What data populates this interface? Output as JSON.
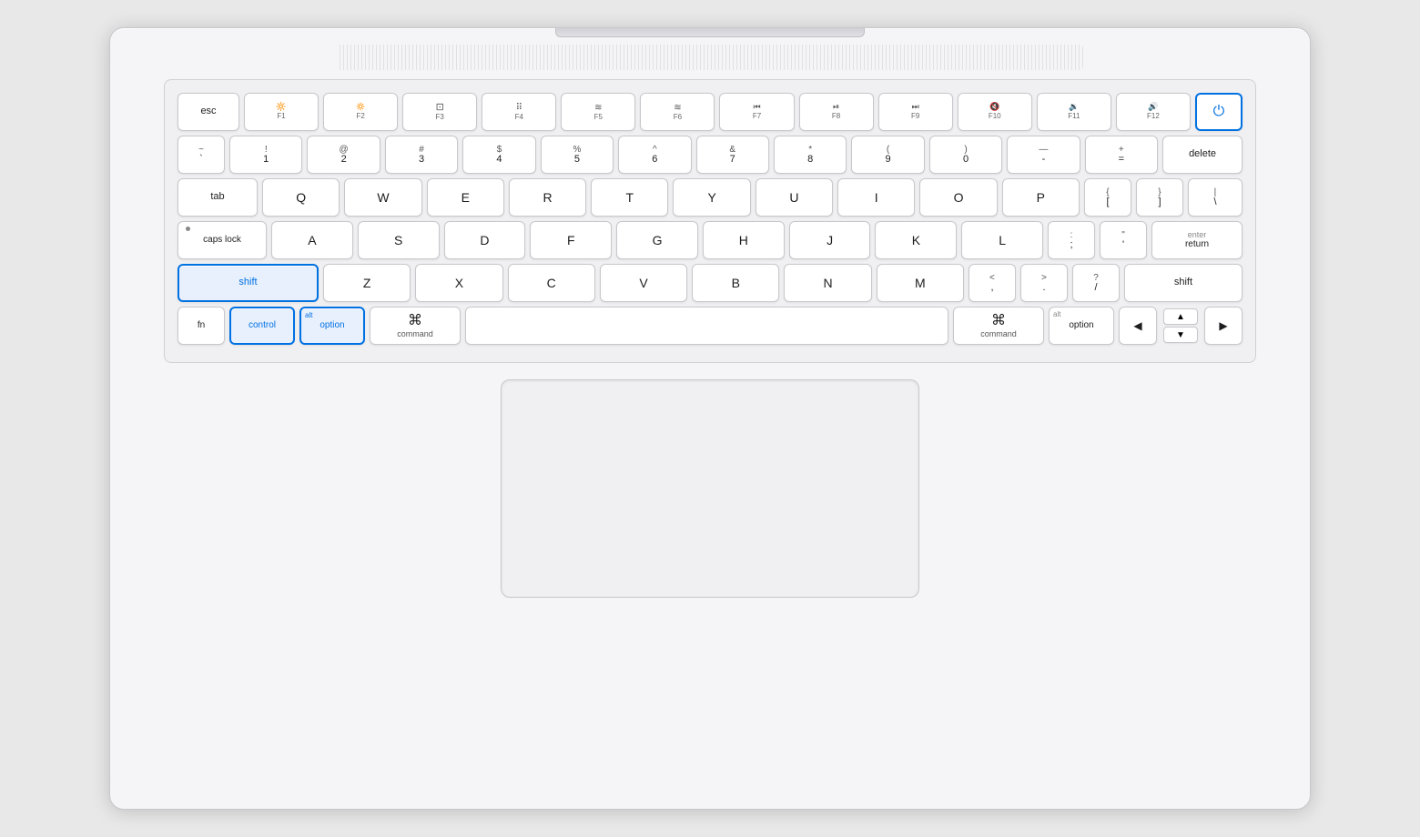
{
  "keyboard": {
    "rows": {
      "fn_row": {
        "esc": "esc",
        "f1": {
          "icon": "☀",
          "label": "F1"
        },
        "f2": {
          "icon": "☀",
          "label": "F2"
        },
        "f3": {
          "icon": "⊞",
          "label": "F3"
        },
        "f4": {
          "icon": "⊞⊞",
          "label": "F4"
        },
        "f5": {
          "icon": "≋",
          "label": "F5"
        },
        "f6": {
          "icon": "≋",
          "label": "F6"
        },
        "f7": {
          "icon": "◀◀",
          "label": "F7"
        },
        "f8": {
          "icon": "▶‖",
          "label": "F8"
        },
        "f9": {
          "icon": "▶▶",
          "label": "F9"
        },
        "f10": {
          "icon": "◁",
          "label": "F10"
        },
        "f11": {
          "icon": "▷",
          "label": "F11"
        },
        "f12": {
          "icon": "▷▷",
          "label": "F12"
        },
        "power": "⏻"
      },
      "num_row": {
        "keys": [
          {
            "top": "~",
            "bottom": "`"
          },
          {
            "top": "!",
            "bottom": "1"
          },
          {
            "top": "@",
            "bottom": "2"
          },
          {
            "top": "#",
            "bottom": "3"
          },
          {
            "top": "$",
            "bottom": "4"
          },
          {
            "top": "%",
            "bottom": "5"
          },
          {
            "top": "^",
            "bottom": "6"
          },
          {
            "top": "&",
            "bottom": "7"
          },
          {
            "top": "*",
            "bottom": "8"
          },
          {
            "top": "(",
            "bottom": "9"
          },
          {
            "top": ")",
            "bottom": "0"
          },
          {
            "top": "—",
            "bottom": "-"
          },
          {
            "top": "+",
            "bottom": "="
          },
          {
            "label": "delete"
          }
        ]
      },
      "tab_row": {
        "keys": [
          "tab",
          "Q",
          "W",
          "E",
          "R",
          "T",
          "Y",
          "U",
          "I",
          "O",
          "P",
          {
            "top": "{",
            "bottom": "["
          },
          {
            "top": "}",
            "bottom": "]"
          },
          {
            "top": "|",
            "bottom": "\\"
          }
        ]
      },
      "caps_row": {
        "keys": [
          "caps lock",
          "A",
          "S",
          "D",
          "F",
          "G",
          "H",
          "J",
          "K",
          "L",
          {
            "top": ":",
            "bottom": ";"
          },
          {
            "top": "\"",
            "bottom": "'"
          },
          "enter/return"
        ]
      },
      "shift_row": {
        "keys": [
          "shift",
          "Z",
          "X",
          "C",
          "V",
          "B",
          "N",
          "M",
          {
            "top": "<",
            "bottom": ","
          },
          {
            "top": ">",
            "bottom": "."
          },
          {
            "top": "?",
            "bottom": "/"
          },
          "shift"
        ]
      },
      "bottom_row": {
        "fn": "fn",
        "control": "control",
        "option_left": {
          "alt": "alt",
          "main": "option"
        },
        "command_left": {
          "symbol": "⌘",
          "label": "command"
        },
        "space": "",
        "command_right": {
          "symbol": "⌘",
          "label": "command"
        },
        "option_right": {
          "alt": "alt",
          "main": "option"
        },
        "arrow_left": "◀",
        "arrow_up": "▲",
        "arrow_down": "▼",
        "arrow_right": "▶"
      }
    }
  }
}
